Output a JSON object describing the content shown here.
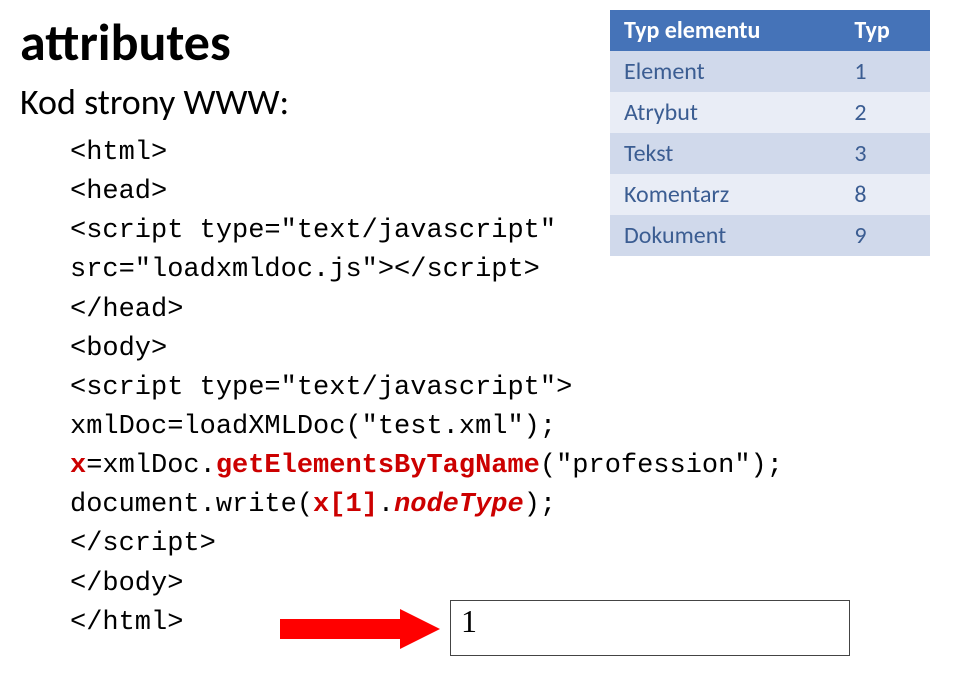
{
  "title": "attributes",
  "subtitle": "Kod strony WWW:",
  "code": {
    "l1": "<html>",
    "l2": "<head>",
    "l3": "<script type=\"text/javascript\"",
    "l4": "src=\"loadxmldoc.js\"></script>",
    "l5": "</head>",
    "l6": "<body>",
    "l7": "<script type=\"text/javascript\">",
    "l8": "xmlDoc=loadXMLDoc(\"test.xml\");",
    "l9a": "x",
    "l9b": "=xmlDoc.",
    "l9c": "getElementsByTagName",
    "l9d": "(\"profession\");",
    "l10a": "document.write(",
    "l10b": "x[1]",
    "l10c": ".",
    "l10d": "nodeType",
    "l10e": ");",
    "l11": "</script>",
    "l12": "</body>",
    "l13": "</html>"
  },
  "table": {
    "h1": "Typ elementu",
    "h2": "Typ",
    "rows": [
      {
        "name": "Element",
        "val": "1"
      },
      {
        "name": "Atrybut",
        "val": "2"
      },
      {
        "name": "Tekst",
        "val": "3"
      },
      {
        "name": "Komentarz",
        "val": "8"
      },
      {
        "name": "Dokument",
        "val": "9"
      }
    ]
  },
  "result": "1"
}
